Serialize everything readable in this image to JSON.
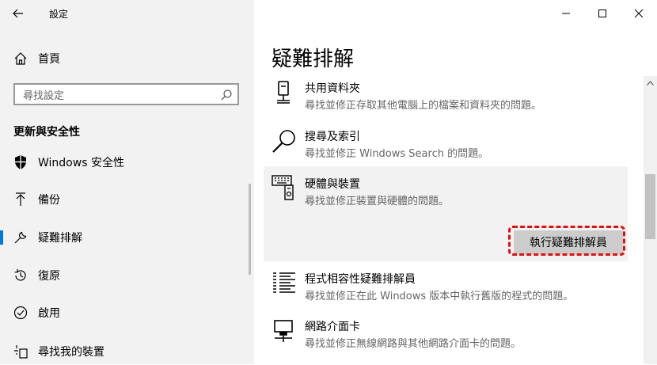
{
  "window": {
    "title": "設定"
  },
  "sidebar": {
    "home_label": "首頁",
    "search_placeholder": "尋找設定",
    "section_title": "更新與安全性",
    "items": [
      {
        "label": "Windows 安全性",
        "icon": "shield-icon"
      },
      {
        "label": "備份",
        "icon": "backup-arrow-icon"
      },
      {
        "label": "疑難排解",
        "icon": "wrench-icon",
        "selected": true
      },
      {
        "label": "復原",
        "icon": "recovery-icon"
      },
      {
        "label": "啟用",
        "icon": "activation-check-icon"
      },
      {
        "label": "尋找我的裝置",
        "icon": "find-device-icon"
      }
    ]
  },
  "main": {
    "title": "疑難排解",
    "troubleshooters": [
      {
        "name": "共用資料夾",
        "desc": "尋找並修正存取其他電腦上的檔案和資料夾的問題。",
        "icon": "shared-folder-icon"
      },
      {
        "name": "搜尋及索引",
        "desc": "尋找並修正 Windows Search 的問題。",
        "icon": "search-magnifier-icon"
      },
      {
        "name": "硬體與裝置",
        "desc": "尋找並修正裝置與硬體的問題。",
        "icon": "hardware-devices-icon",
        "expanded": true,
        "run_button": "執行疑難排解員"
      },
      {
        "name": "程式相容性疑難排解員",
        "desc": "尋找並修正在此 Windows 版本中執行舊版的程式的問題。",
        "icon": "program-list-icon"
      },
      {
        "name": "網路介面卡",
        "desc": "尋找並修正無線網路與其他網路介面卡的問題。",
        "icon": "network-adapter-icon"
      }
    ]
  },
  "colors": {
    "accent": "#0078d7",
    "highlight": "#e01010",
    "sidebar_bg": "#f2f2f2"
  }
}
